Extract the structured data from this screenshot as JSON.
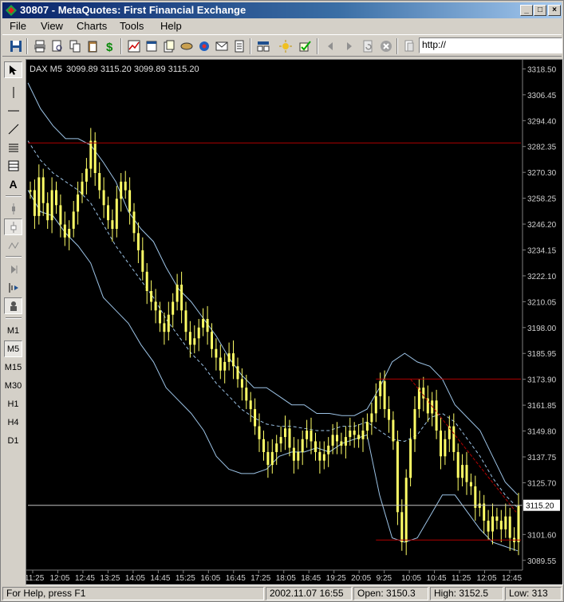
{
  "window": {
    "title": "30807 - MetaQuotes: First Financial Exchange",
    "buttons": {
      "minimize": "_",
      "maximize": "□",
      "close": "×"
    }
  },
  "menu": [
    "File",
    "View",
    "Charts",
    "Tools",
    "Help"
  ],
  "toolbar": {
    "address_value": "http://",
    "icons": [
      "save-icon",
      "print-icon",
      "print-preview-icon",
      "copy-icon",
      "paste-icon",
      "dollar-icon",
      "chart-icon",
      "new-window-icon",
      "open-icon",
      "refresh-icon",
      "mail-icon",
      "clipboard-icon",
      "bar-chart-icon",
      "settings-icon",
      "check-icon",
      "back-icon",
      "forward-icon",
      "reload-icon",
      "stop-icon",
      "page-icon"
    ]
  },
  "left_toolbar": {
    "tools": [
      "cursor-icon",
      "vertical-line-icon",
      "horizontal-line-icon",
      "trendline-icon",
      "channel-icon",
      "grid-icon",
      "text-icon",
      "trend-icon",
      "period-icon",
      "indicator-icon",
      "scroll-icon",
      "split-icon",
      "expert-icon"
    ],
    "text_tool": "A",
    "timeframes": [
      "M1",
      "M5",
      "M15",
      "M30",
      "H1",
      "H4",
      "D1"
    ],
    "active_timeframe": "M5"
  },
  "chart": {
    "label": "DAX M5",
    "ohlc": "3099.89 3115.20 3099.89 3115.20",
    "y_ticks": [
      "3318.50",
      "3306.45",
      "3294.40",
      "3282.35",
      "3270.30",
      "3258.25",
      "3246.20",
      "3234.15",
      "3222.10",
      "3210.05",
      "3198.00",
      "3185.95",
      "3173.90",
      "3161.85",
      "3149.80",
      "3137.75",
      "3125.70",
      "3101.60",
      "3089.55"
    ],
    "y_tick_values": [
      3318.5,
      3306.45,
      3294.4,
      3282.35,
      3270.3,
      3258.25,
      3246.2,
      3234.15,
      3222.1,
      3210.05,
      3198.0,
      3185.95,
      3173.9,
      3161.85,
      3149.8,
      3137.75,
      3125.7,
      3101.6,
      3089.55
    ],
    "current_price_label": "3115.20",
    "current_price": 3115.2,
    "x_ticks": [
      "11:25",
      "12:05",
      "12:45",
      "13:25",
      "14:05",
      "14:45",
      "15:25",
      "16:05",
      "16:45",
      "17:25",
      "18:05",
      "18:45",
      "19:25",
      "20:05",
      "9:25",
      "10:05",
      "10:45",
      "11:25",
      "12:05",
      "12:45"
    ],
    "colors": {
      "bars": "#ffff66",
      "bands": "#9cc3e6",
      "levels": "#b00000",
      "current": "#c0c0c0"
    }
  },
  "chart_data": {
    "type": "line",
    "title": "DAX M5",
    "ylim": [
      3085,
      3322
    ],
    "close": [
      3262,
      3250,
      3268,
      3256,
      3248,
      3262,
      3255,
      3246,
      3240,
      3244,
      3252,
      3260,
      3266,
      3272,
      3285,
      3270,
      3262,
      3255,
      3248,
      3244,
      3258,
      3266,
      3262,
      3252,
      3242,
      3234,
      3224,
      3215,
      3210,
      3206,
      3200,
      3196,
      3204,
      3210,
      3218,
      3206,
      3196,
      3190,
      3193,
      3198,
      3202,
      3196,
      3188,
      3184,
      3178,
      3182,
      3186,
      3180,
      3174,
      3170,
      3164,
      3160,
      3152,
      3146,
      3140,
      3134,
      3140,
      3144,
      3147,
      3151,
      3142,
      3136,
      3140,
      3146,
      3150,
      3145,
      3140,
      3136,
      3139,
      3143,
      3148,
      3145,
      3143,
      3147,
      3150,
      3148,
      3146,
      3150,
      3154,
      3158,
      3166,
      3173,
      3160,
      3155,
      3145,
      3112,
      3098,
      3128,
      3146,
      3160,
      3170,
      3165,
      3158,
      3164,
      3150,
      3138,
      3146,
      3152,
      3140,
      3128,
      3134,
      3126,
      3124,
      3114,
      3116,
      3108,
      3103,
      3110,
      3108,
      3104,
      3110,
      3100,
      3098,
      3115
    ],
    "upper_band": [
      3312,
      3300,
      3292,
      3286,
      3286,
      3283,
      3275,
      3266,
      3252,
      3244,
      3238,
      3226,
      3216,
      3210,
      3202,
      3194,
      3184,
      3176,
      3170,
      3170,
      3166,
      3162,
      3162,
      3158,
      3158,
      3157,
      3157,
      3160,
      3170,
      3182,
      3186,
      3182,
      3180,
      3174,
      3162,
      3156,
      3150,
      3138,
      3126,
      3120
    ],
    "middle_band": [
      3285,
      3276,
      3270,
      3266,
      3262,
      3256,
      3246,
      3236,
      3228,
      3220,
      3212,
      3202,
      3194,
      3186,
      3180,
      3172,
      3166,
      3160,
      3156,
      3153,
      3152,
      3152,
      3151,
      3150,
      3150,
      3152,
      3152,
      3154,
      3150,
      3146,
      3145,
      3148,
      3156,
      3158,
      3154,
      3146,
      3138,
      3128,
      3120,
      3114
    ],
    "lower_band": [
      3262,
      3252,
      3250,
      3242,
      3236,
      3228,
      3212,
      3206,
      3200,
      3190,
      3182,
      3170,
      3164,
      3158,
      3150,
      3138,
      3132,
      3130,
      3130,
      3132,
      3138,
      3140,
      3140,
      3142,
      3140,
      3144,
      3146,
      3148,
      3120,
      3100,
      3098,
      3100,
      3110,
      3120,
      3120,
      3112,
      3104,
      3098,
      3096,
      3094
    ],
    "levels": {
      "upper_resistance": 3284,
      "mid_resistance": 3174,
      "lower_support": 3099
    }
  },
  "status": {
    "help": "For Help, press F1",
    "datetime": "2002.11.07 16:55",
    "open": "Open: 3150.3",
    "high": "High: 3152.5",
    "low": "Low: 313"
  }
}
